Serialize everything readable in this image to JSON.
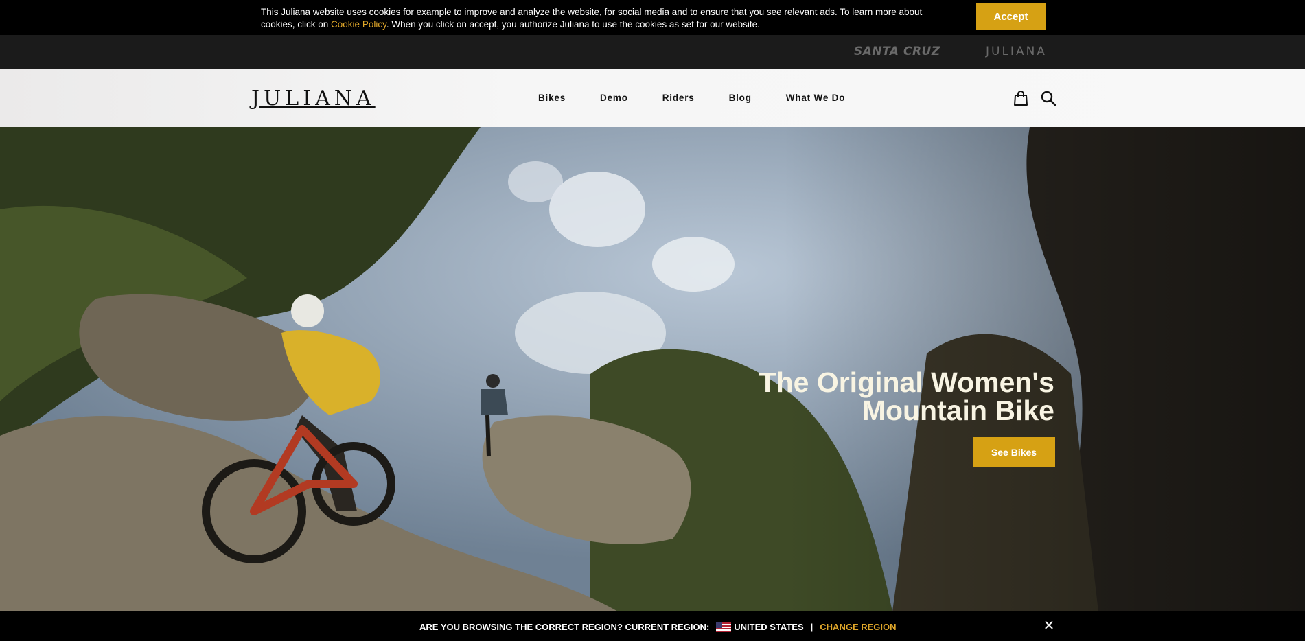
{
  "cookie_bar": {
    "text_before": "This Juliana website uses cookies for example to improve and analyze the website, for social media and to ensure that you see relevant ads. To learn more about cookies, click on ",
    "link_label": "Cookie Policy",
    "text_after": ". When you click on accept, you authorize Juliana to use the cookies as set for our website.",
    "accept_label": "Accept"
  },
  "brand_bar": {
    "santa_cruz": "SANTA CRUZ",
    "juliana": "JULIANA"
  },
  "header": {
    "logo": "JULIANA",
    "nav": [
      "Bikes",
      "Demo",
      "Riders",
      "Blog",
      "What We Do"
    ],
    "icons": [
      "shopping-bag-icon",
      "search-icon"
    ]
  },
  "hero": {
    "title_line1": "The Original Women's",
    "title_line2": "Mountain Bike",
    "cta_label": "See Bikes"
  },
  "region_bar": {
    "question": "ARE YOU BROWSING THE CORRECT REGION? CURRENT REGION:",
    "flag_icon": "us-flag-icon",
    "current_region": "UNITED STATES",
    "separator": "|",
    "change_label": "CHANGE REGION",
    "close_icon": "close-icon"
  },
  "colors": {
    "accent": "#d6a114",
    "link": "#e0a72a",
    "hero_text": "#f8f4e3"
  }
}
